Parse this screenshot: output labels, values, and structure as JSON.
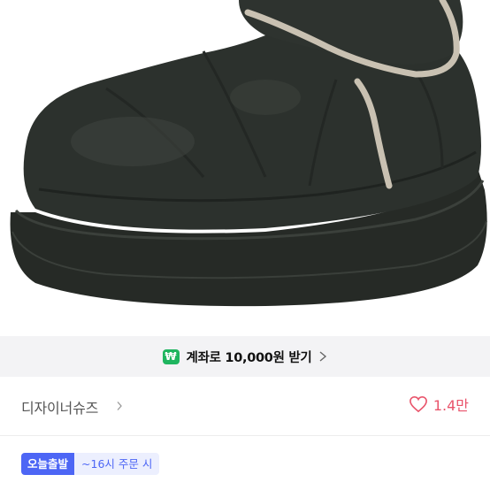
{
  "product": {
    "image_alt": "product-photo-black-padded-boot"
  },
  "promo": {
    "icon_label": "₩",
    "text": "계좌로 10,000원 받기"
  },
  "shop": {
    "name": "디자이너슈즈",
    "like_count": "1.4만"
  },
  "delivery": {
    "badge": "오늘출발",
    "cutoff": "~16시 주문 시"
  },
  "colors": {
    "accent_green": "#1fb55f",
    "accent_blue": "#4d66f5",
    "heart_pink": "#e9546b"
  }
}
